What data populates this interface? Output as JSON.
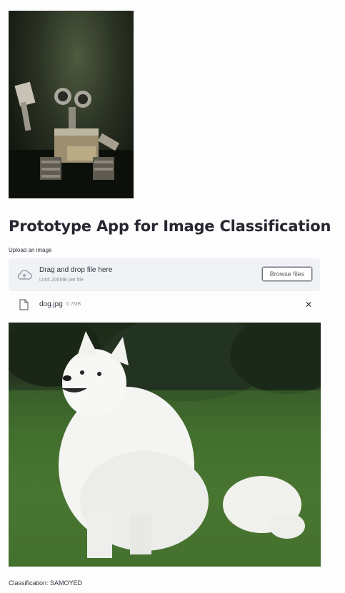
{
  "app": {
    "title": "Prototype App for Image Classification"
  },
  "uploader": {
    "label": "Upload an image",
    "drop_text": "Drag and drop file here",
    "limit_text": "Limit 200MB per file",
    "browse_button": "Browse files"
  },
  "uploaded_file": {
    "name": "dog.jpg",
    "size": "0.7MB"
  },
  "result": {
    "text": "Classification: SAMOYED"
  },
  "icons": {
    "upload": "cloud-upload-icon",
    "file": "file-icon",
    "remove": "close-icon"
  },
  "colors": {
    "dropzone_bg": "#f0f2f6",
    "text": "#262730",
    "muted": "#8a8d96"
  }
}
